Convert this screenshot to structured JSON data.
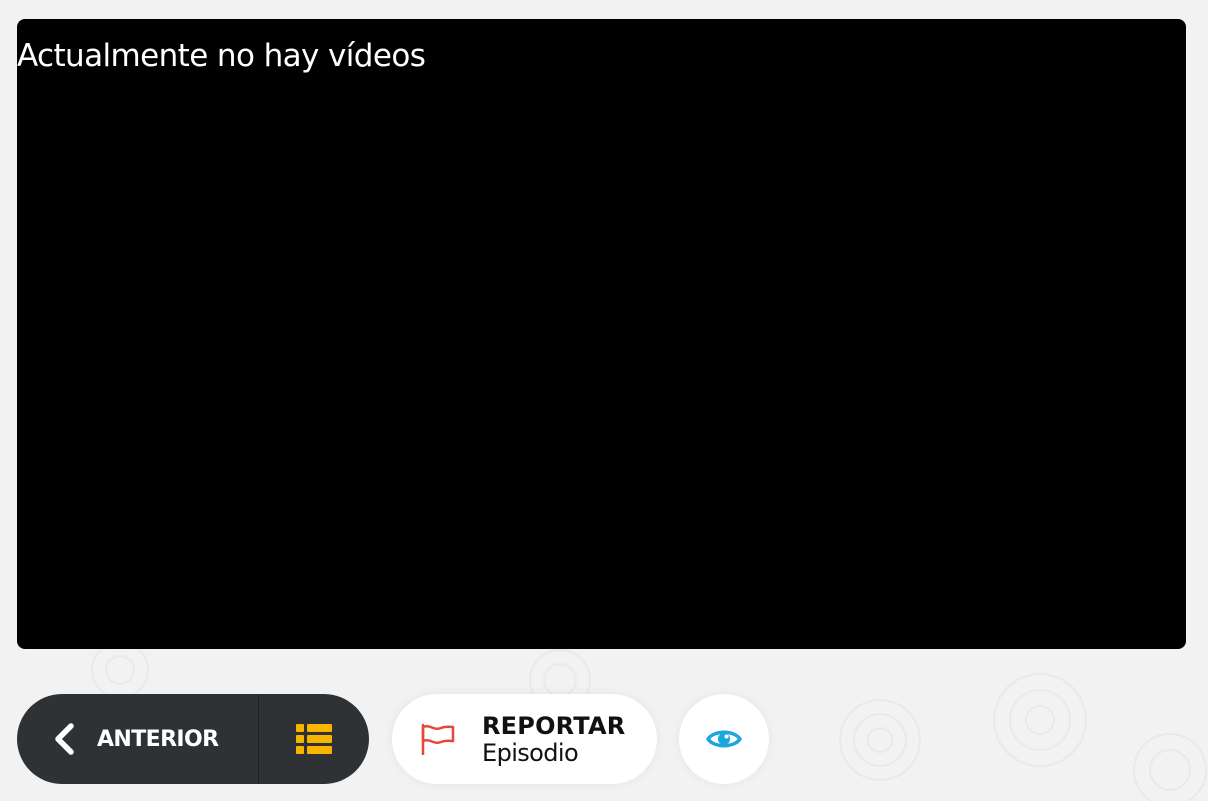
{
  "player": {
    "message": "Actualmente no hay vídeos"
  },
  "navigation": {
    "previous_label": "ANTERIOR",
    "previous_icon": "chevron-left-icon",
    "list_icon": "list-icon"
  },
  "report": {
    "title": "REPORTAR",
    "subtitle": "Episodio",
    "icon": "flag-icon"
  },
  "watch": {
    "icon": "eye-icon"
  },
  "colors": {
    "background": "#f2f2f2",
    "player": "#000000",
    "nav_pill": "#2f3235",
    "list_icon": "#f7b500",
    "flag_icon": "#e8453c",
    "eye_icon": "#1aa7e0",
    "button_white": "#ffffff"
  }
}
